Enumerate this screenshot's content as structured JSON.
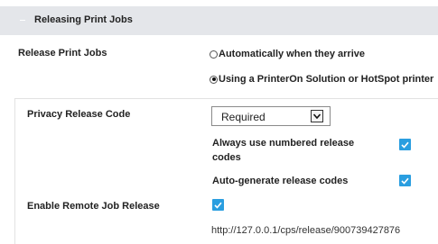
{
  "section": {
    "title": "Releasing Print Jobs"
  },
  "release_print_jobs": {
    "label": "Release Print Jobs",
    "options": [
      {
        "label": "Automatically when they arrive",
        "selected": false
      },
      {
        "label": "Using a PrinterOn Solution or HotSpot printer",
        "selected": true
      }
    ]
  },
  "privacy_release_code": {
    "label": "Privacy Release Code",
    "selected_value": "Required"
  },
  "checkboxes": {
    "numbered_codes": {
      "label": "Always use numbered release codes",
      "checked": true
    },
    "auto_generate": {
      "label": "Auto-generate release codes",
      "checked": true
    }
  },
  "remote_release": {
    "label": "Enable Remote Job Release",
    "checked": true,
    "url": "http://127.0.0.1/cps/release/900739427876"
  },
  "colors": {
    "accent": "#2a9ee0",
    "header_bg": "#e4e6ea"
  }
}
